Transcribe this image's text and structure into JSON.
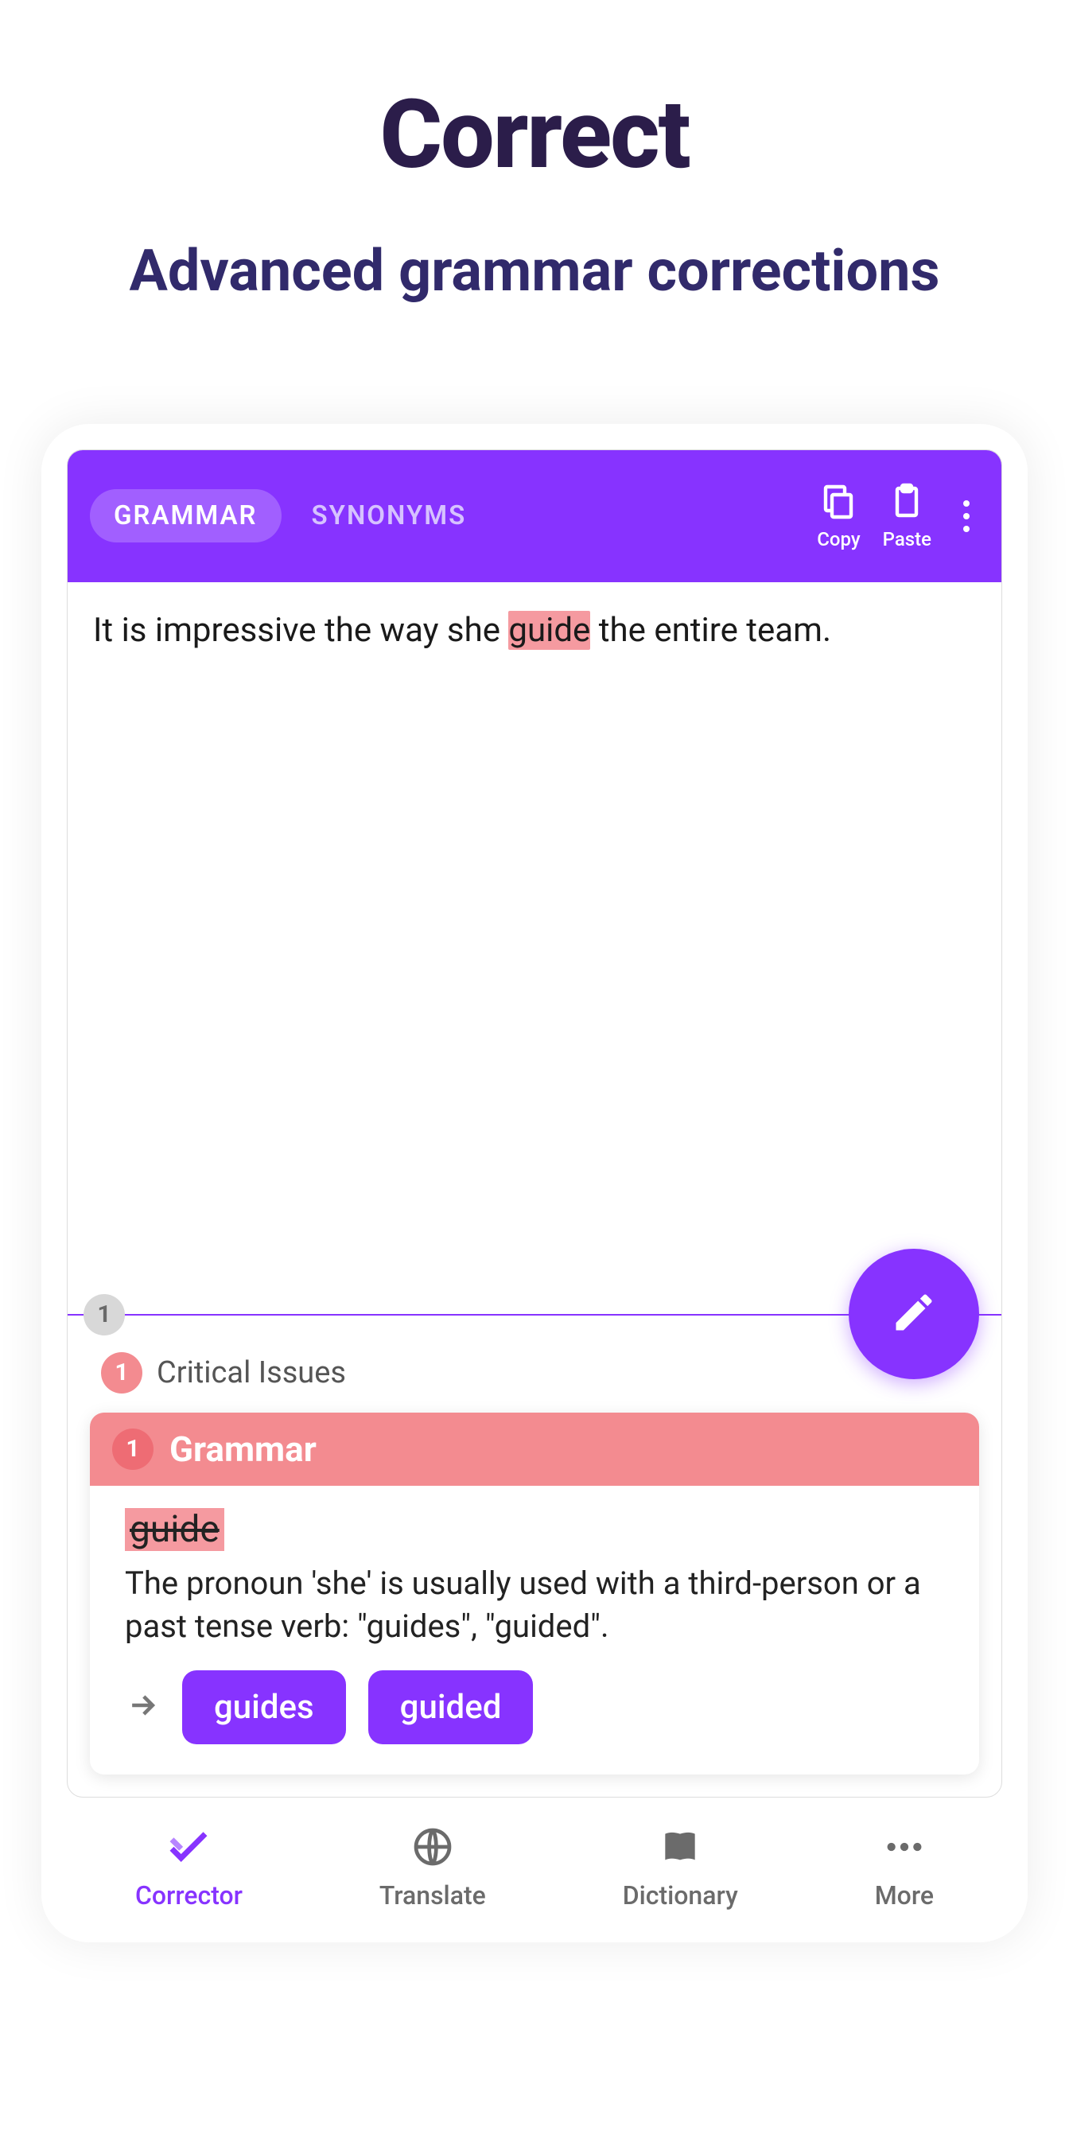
{
  "hero": {
    "title": "Correct",
    "subtitle": "Advanced grammar corrections"
  },
  "topbar": {
    "tabs": {
      "grammar": "GRAMMAR",
      "synonyms": "SYNONYMS"
    },
    "copy_label": "Copy",
    "paste_label": "Paste"
  },
  "editor": {
    "before": "It is impressive the way she ",
    "highlight": "guide",
    "after": " the entire team."
  },
  "divider": {
    "count": "1"
  },
  "issues": {
    "count": "1",
    "title": "Critical Issues"
  },
  "card": {
    "count": "1",
    "category": "Grammar",
    "word": "guide",
    "explanation": "The pronoun 'she' is usually used with a third-person or a past tense verb: \"guides\", \"guided\".",
    "suggestions": {
      "s1": "guides",
      "s2": "guided"
    }
  },
  "nav": {
    "corrector": "Corrector",
    "translate": "Translate",
    "dictionary": "Dictionary",
    "more": "More"
  }
}
